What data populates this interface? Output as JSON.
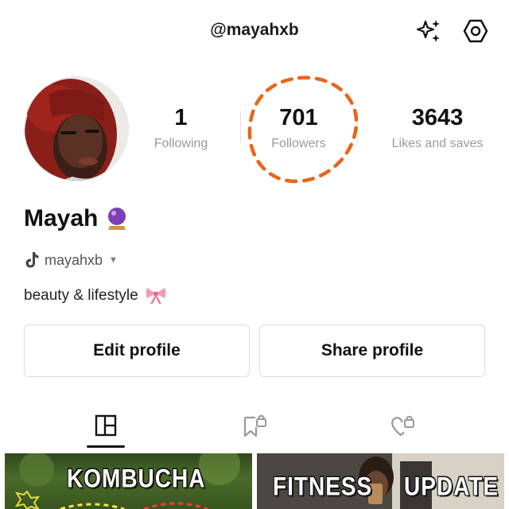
{
  "header": {
    "username": "@mayahxb",
    "sparkle_icon": "sparkles-icon",
    "settings_icon": "hexagon-settings-icon"
  },
  "stats": {
    "following": {
      "value": "1",
      "label": "Following"
    },
    "followers": {
      "value": "701",
      "label": "Followers"
    },
    "likes": {
      "value": "3643",
      "label": "Likes and saves"
    }
  },
  "annotation": {
    "color": "#e8651a",
    "style": "dashed-circle"
  },
  "profile": {
    "display_name": "Mayah",
    "name_emoji": "crystal-ball-emoji",
    "tiktok_handle": "mayahxb",
    "bio": "beauty & lifestyle",
    "bio_emoji": "ribbon-emoji"
  },
  "buttons": {
    "edit": "Edit profile",
    "share": "Share profile"
  },
  "tabs": [
    {
      "name": "posts",
      "icon": "grid-icon",
      "active": true
    },
    {
      "name": "saved",
      "icon": "bookmark-lock-icon",
      "active": false
    },
    {
      "name": "liked",
      "icon": "heart-lock-icon",
      "active": false
    }
  ],
  "posts": [
    {
      "title": "KOMBUCHA"
    },
    {
      "title_left": "FITNESS",
      "title_right": "UPDATE"
    }
  ]
}
